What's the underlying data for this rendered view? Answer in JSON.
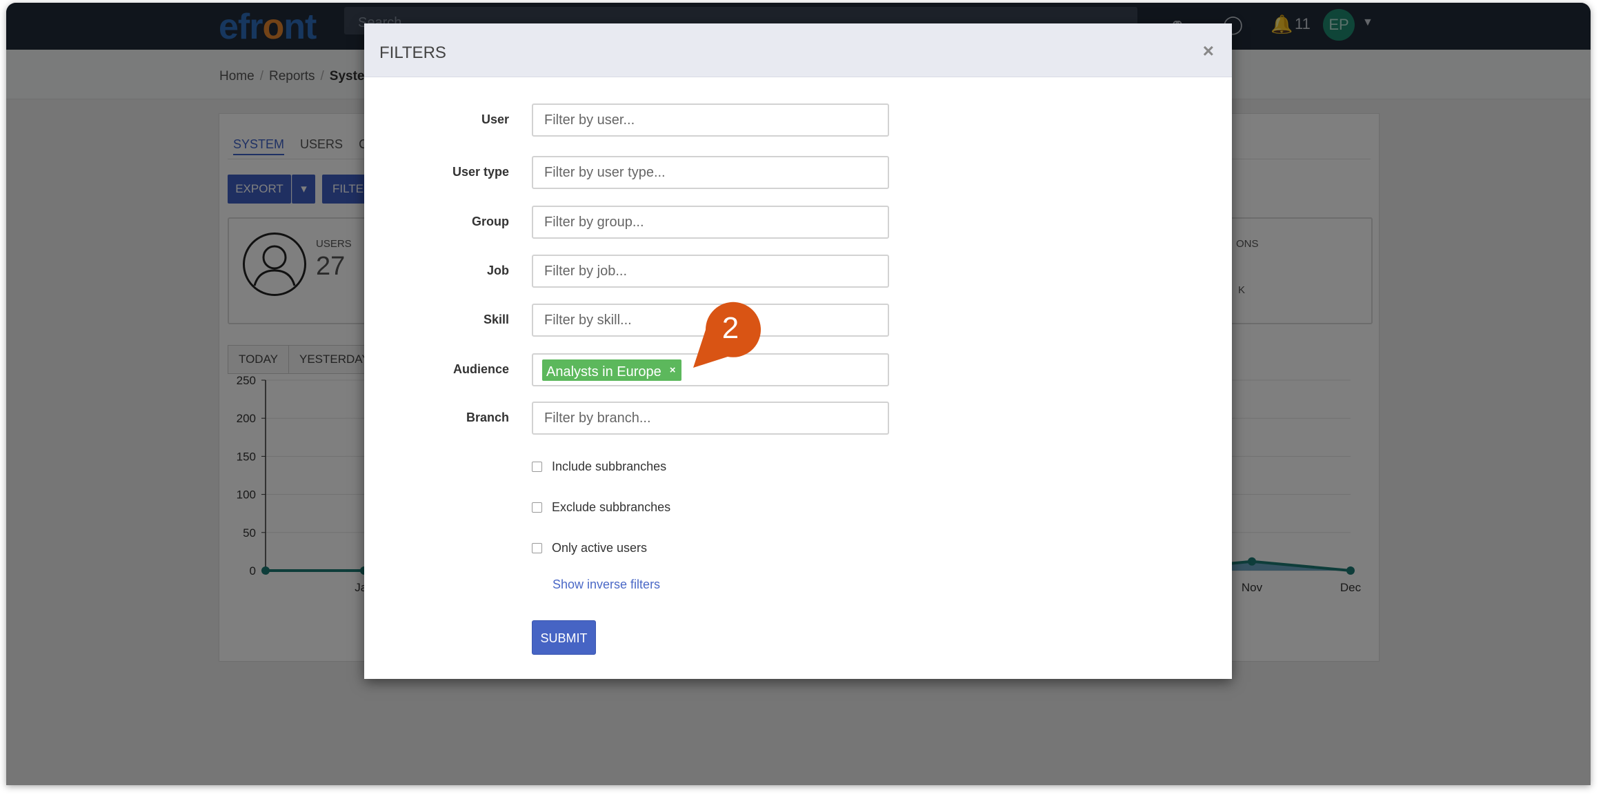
{
  "navbar": {
    "logo_left": "efr",
    "logo_o": "o",
    "logo_right": "nt",
    "search_placeholder": "Search",
    "notification_count": "11",
    "user_initials": "EP"
  },
  "breadcrumb": {
    "items": [
      "Home",
      "Reports",
      "Syste"
    ]
  },
  "tabs": [
    "SYSTEM",
    "USERS",
    "CO"
  ],
  "toolbar": {
    "export_label": "EXPORT",
    "filter_label": "FILTER"
  },
  "stats": {
    "users_label": "USERS",
    "users_value": "27",
    "right_label": "ONS",
    "right_value": "K"
  },
  "periods": [
    "TODAY",
    "YESTERDAY"
  ],
  "chart_data": {
    "type": "area",
    "y_ticks": [
      "250",
      "200",
      "150",
      "100",
      "50",
      "0"
    ],
    "ylim": [
      0,
      250
    ],
    "x_labels_visible": [
      "Jan",
      "Nov",
      "Dec"
    ],
    "series": [
      {
        "values": [
          0,
          0,
          0,
          0,
          0,
          0,
          0,
          0,
          0,
          0,
          12,
          0
        ]
      }
    ],
    "colors": {
      "line": "#1c7a74",
      "fill": "#3b8ab0"
    },
    "grid": true
  },
  "modal": {
    "title": "FILTERS",
    "close_symbol": "×",
    "fields": {
      "user_label": "User",
      "user_placeholder": "Filter by user...",
      "user_type_label": "User type",
      "user_type_placeholder": "Filter by user type...",
      "group_label": "Group",
      "group_placeholder": "Filter by group...",
      "job_label": "Job",
      "job_placeholder": "Filter by job...",
      "skill_label": "Skill",
      "skill_placeholder": "Filter by skill...",
      "audience_label": "Audience",
      "audience_tag": "Analysts in Europe",
      "audience_tag_remove": "×",
      "branch_label": "Branch",
      "branch_placeholder": "Filter by branch..."
    },
    "checkboxes": {
      "include_subbranches": "Include subbranches",
      "exclude_subbranches": "Exclude subbranches",
      "only_active_users": "Only active users"
    },
    "inverse_link": "Show inverse filters",
    "submit_label": "SUBMIT"
  },
  "step_marker": {
    "number": "2",
    "color": "#d95414"
  }
}
